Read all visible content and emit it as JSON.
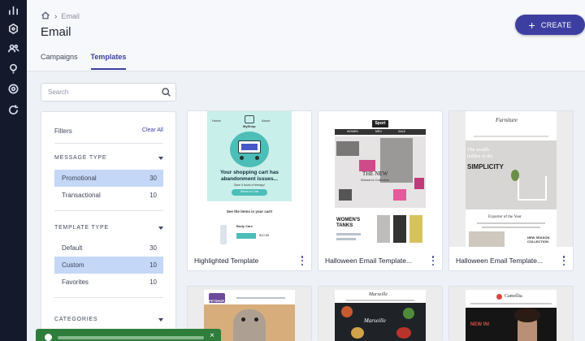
{
  "rail": {
    "icons": [
      "bar-chart-icon",
      "hexagon-icon",
      "users-icon",
      "lightbulb-icon",
      "target-icon",
      "refresh-icon"
    ]
  },
  "breadcrumb": {
    "home_icon": "home-icon",
    "item": "Email"
  },
  "page": {
    "title": "Email"
  },
  "tabs": [
    {
      "label": "Campaigns"
    },
    {
      "label": "Templates"
    }
  ],
  "create_button": {
    "label": "CREATE"
  },
  "search": {
    "placeholder": "Search"
  },
  "filters": {
    "heading": "Filters",
    "clear_label": "Clear All",
    "message_type": {
      "label": "MESSAGE TYPE",
      "items": [
        {
          "label": "Promotional",
          "count": "30"
        },
        {
          "label": "Transactional",
          "count": "10"
        }
      ]
    },
    "template_type": {
      "label": "TEMPLATE TYPE",
      "items": [
        {
          "label": "Default",
          "count": "30"
        },
        {
          "label": "Custom",
          "count": "10"
        },
        {
          "label": "Favorites",
          "count": "10"
        }
      ]
    },
    "categories": {
      "label": "CATEGORIES"
    }
  },
  "cards": [
    {
      "label": "Highlighted Template",
      "thumb": {
        "headline": "Your shopping cart has abandonment issues...",
        "sub": "Save it hours of therapy!",
        "see": "See the items in your cart!",
        "brand": "MyShop",
        "button": "Return to Cart",
        "item": "Body Care",
        "price": "$10.50"
      }
    },
    {
      "label": "Halloween Email Template...",
      "thumb": {
        "brand": "Sport",
        "nav": [
          "WOMEN",
          "MEN",
          "SALE"
        ],
        "big": "THE NEW",
        "small": "Women's Collection",
        "tanks": "WOMEN'S TANKS"
      }
    },
    {
      "label": "Halloween Email Template...",
      "thumb": {
        "brand": "Furniture",
        "line1": "The wealth",
        "line2": "hidden in the",
        "big": "SIMPLICITY",
        "exporter": "Exporter of the Year",
        "newseason": "NEW SEASON COLLECTION"
      }
    },
    {
      "label": "",
      "thumb": {
        "brand": "PETSHOP"
      }
    },
    {
      "label": "",
      "thumb": {
        "brand": "Marseille",
        "big": "Marseille"
      }
    },
    {
      "label": "",
      "thumb": {
        "brand": "Camellia",
        "big": "NEW IN!"
      }
    }
  ],
  "toast": {
    "close_label": "×"
  },
  "colors": {
    "accent": "#3d3fa0",
    "rail": "#14192c",
    "selected_row": "#c5d7f6",
    "toast": "#2e7d3a"
  }
}
